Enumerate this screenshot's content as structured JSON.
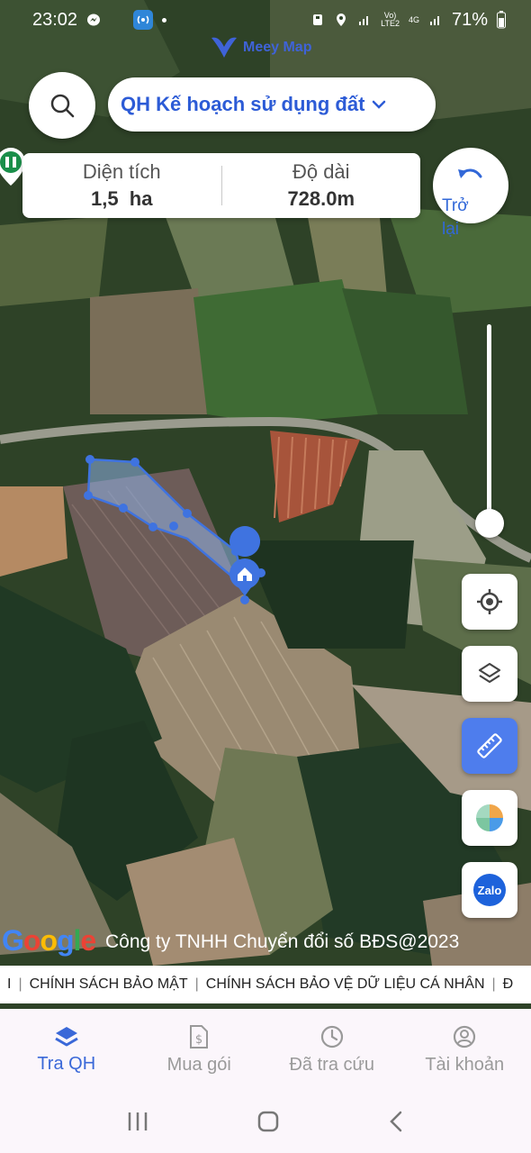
{
  "status_bar": {
    "time": "23:02",
    "network_top": "Vo)",
    "network_bottom": "LTE2",
    "network_type": "4G",
    "battery": "71%"
  },
  "brand": {
    "name": "Meey Map"
  },
  "plan_select": {
    "selected": "QH Kế hoạch sử dụng đất"
  },
  "measure": {
    "area_label": "Diện tích",
    "area_value": "1,5  ha",
    "length_label": "Độ dài",
    "length_value": "728.0m"
  },
  "undo": {
    "label": "Trở lại"
  },
  "tools": [
    {
      "icon": "locate-icon"
    },
    {
      "icon": "layers-icon"
    },
    {
      "icon": "ruler-icon",
      "active": true
    },
    {
      "icon": "pie-chart-icon"
    },
    {
      "icon": "zalo-icon",
      "label": "Zalo"
    }
  ],
  "map": {
    "google_logo": "Google",
    "copyright": "Công ty TNHH Chuyển đổi số BĐS@2023"
  },
  "policy_strip": {
    "lead": "I",
    "item1": "CHÍNH SÁCH BẢO MẬT",
    "item2": "CHÍNH SÁCH BẢO VỆ DỮ LIỆU CÁ NHÂN",
    "tail": "Đ"
  },
  "bottom_nav": [
    {
      "label": "Tra QH",
      "icon": "layers-icon",
      "active": true
    },
    {
      "label": "Mua gói",
      "icon": "invoice-icon",
      "active": false
    },
    {
      "label": "Đã tra cứu",
      "icon": "clock-icon",
      "active": false
    },
    {
      "label": "Tài khoản",
      "icon": "user-icon",
      "active": false
    }
  ],
  "colors": {
    "accent": "#3a68d8",
    "polygon_fill": "#8fb2e8",
    "polygon_stroke": "#3f73e0"
  }
}
